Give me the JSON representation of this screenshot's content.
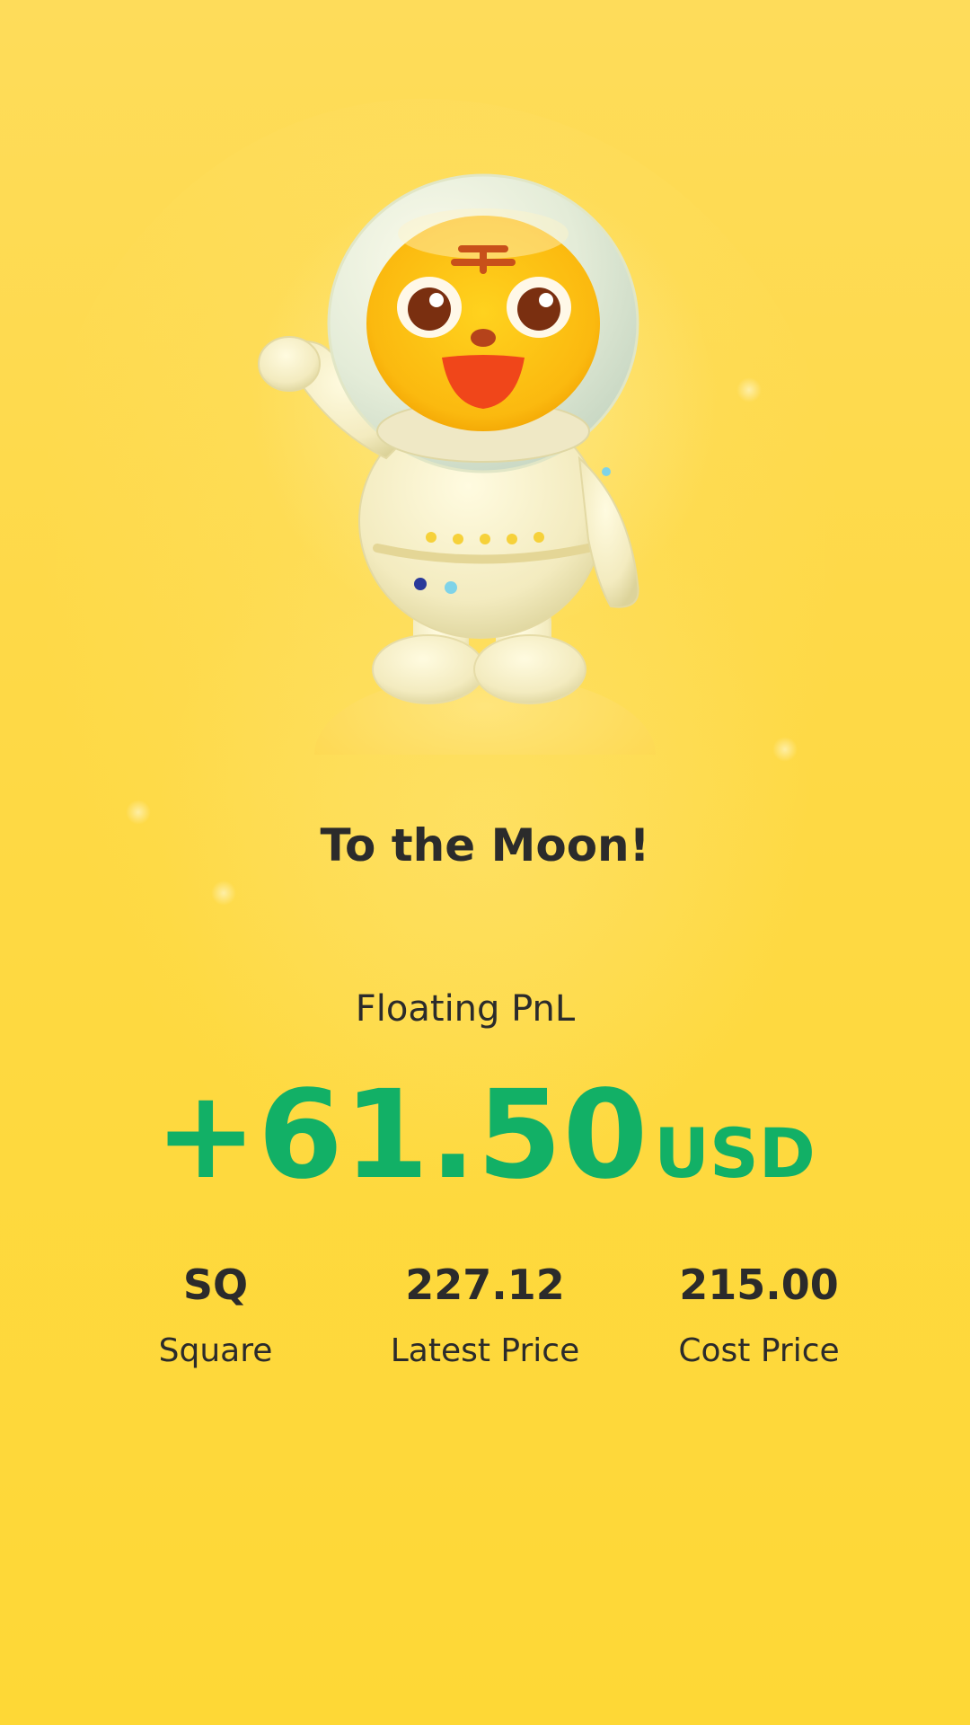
{
  "headline": "To the Moon!",
  "pnl": {
    "label": "Floating PnL",
    "amount": "+61.50",
    "unit": "USD",
    "color": "#12b066"
  },
  "stats": [
    {
      "value": "SQ",
      "label": "Square"
    },
    {
      "value": "227.12",
      "label": "Latest Price"
    },
    {
      "value": "215.00",
      "label": "Cost Price"
    }
  ],
  "colors": {
    "background": "#fed940",
    "text": "#2b2b2b",
    "positive": "#12b066"
  },
  "mascot": "astronaut-tiger-illustration"
}
